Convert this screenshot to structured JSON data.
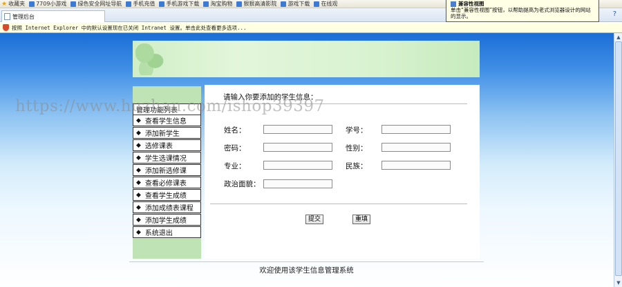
{
  "browser": {
    "favorites_label": "收藏夹",
    "favorites": [
      "7709小游戏",
      "绿色安全网址导航",
      "手机充值",
      "手机游戏下载",
      "淘宝购物",
      "狠狠高清影院",
      "游戏下载",
      "在线观"
    ],
    "chevron": "»",
    "tab_title": "管理后台",
    "help_glyph": "?",
    "balloon": {
      "title": "兼容性视图",
      "text": "单击“兼容性视图”按钮，以帮助提高为老式浏览器设计的网站的显示。"
    },
    "infobar_text": "按照 Internet Explorer 中的默认设置现在已关闭 Intranet 设置。单击此处查看更多选项..."
  },
  "sidebar": {
    "header": "管理功能列表",
    "items": [
      {
        "label": "查看学生信息"
      },
      {
        "label": "添加新学生"
      },
      {
        "label": "选修课表"
      },
      {
        "label": "学生选课情况"
      },
      {
        "label": "添加新选修课"
      },
      {
        "label": "查看必修课表"
      },
      {
        "label": "查看学生成绩"
      },
      {
        "label": "添加成绩表课程"
      },
      {
        "label": "添加学生成绩"
      },
      {
        "label": "系统退出"
      }
    ]
  },
  "form": {
    "prompt": "请输入你要添加的学生信息：",
    "fields": {
      "name": {
        "label": "姓名：",
        "value": ""
      },
      "student_id": {
        "label": "学号：",
        "value": ""
      },
      "password": {
        "label": "密码：",
        "value": ""
      },
      "gender": {
        "label": "性别：",
        "value": ""
      },
      "major": {
        "label": "专业：",
        "value": ""
      },
      "ethnicity": {
        "label": "民族：",
        "value": ""
      },
      "political_status": {
        "label": "政治面貌：",
        "value": ""
      }
    },
    "submit_label": "提交",
    "reset_label": "重填"
  },
  "footer": {
    "text": "欢迎使用该学生信息管理系统"
  },
  "watermark": "https://www.huzhan.com/ishop39397",
  "colors": {
    "page_top": "#1c6ed6",
    "sidebar_bg": "#bfe3b4",
    "banner": "#d8f2d0"
  }
}
